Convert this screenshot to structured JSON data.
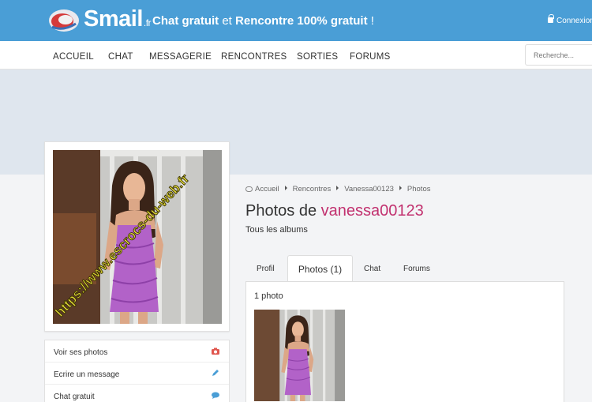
{
  "header": {
    "logo_text": "Smail",
    "logo_suffix": ".fr",
    "tagline_part1": "Chat gratuit",
    "tagline_et": " et ",
    "tagline_part2": "Rencontre 100% gratuit",
    "tagline_end": " !",
    "login_label": "Connexion"
  },
  "nav": {
    "items": [
      "ACCUEIL",
      "CHAT",
      "MESSAGERIE",
      "RENCONTRES",
      "SORTIES",
      "FORUMS"
    ],
    "search_placeholder": "Recherche..."
  },
  "profile": {
    "watermark": "https://www.escrocs-du-web.fr",
    "actions": [
      {
        "label": "Voir ses photos",
        "icon": "camera-icon",
        "color": "#e0574f"
      },
      {
        "label": "Ecrire un message",
        "icon": "pencil-icon",
        "color": "#4a9ed6"
      },
      {
        "label": "Chat gratuit",
        "icon": "chat-bubble-icon",
        "color": "#4a9ed6"
      }
    ]
  },
  "breadcrumb": [
    "Accueil",
    "Rencontres",
    "Vanessa00123",
    "Photos"
  ],
  "page": {
    "title_prefix": "Photos de",
    "username": "vanessa00123",
    "subtitle": "Tous les albums"
  },
  "tabs": [
    "Profil",
    "Photos (1)",
    "Chat",
    "Forums"
  ],
  "gallery": {
    "count_label": "1 photo"
  },
  "colors": {
    "header_blue": "#4a9ed6",
    "username_pink": "#c2316f",
    "banner": "#dfe6ee",
    "dress_purple": "#b262c8"
  }
}
